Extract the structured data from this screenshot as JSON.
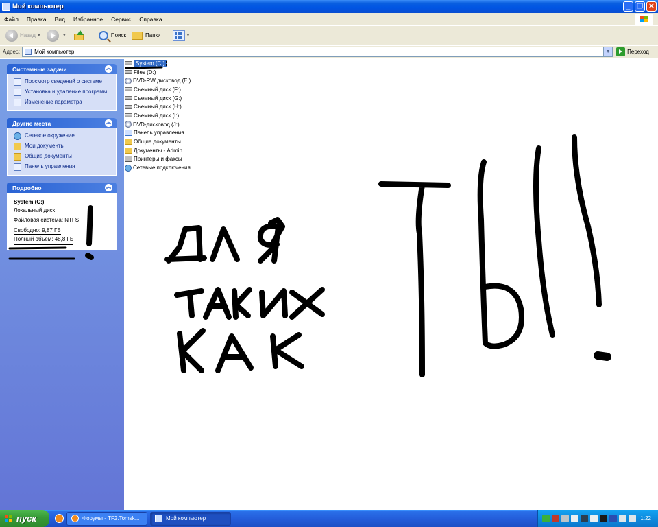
{
  "window": {
    "title": "Мой компьютер"
  },
  "menubar": {
    "items": [
      "Файл",
      "Правка",
      "Вид",
      "Избранное",
      "Сервис",
      "Справка"
    ]
  },
  "toolbar": {
    "back_label": "Назад",
    "search_label": "Поиск",
    "folders_label": "Папки"
  },
  "addressbar": {
    "label": "Адрес:",
    "value": "Мой компьютер",
    "go_label": "Переход"
  },
  "left_panel": {
    "system_tasks": {
      "title": "Системные задачи",
      "items": [
        "Просмотр сведений о системе",
        "Установка и удаление программ",
        "Изменение параметра"
      ]
    },
    "other_places": {
      "title": "Другие места",
      "items": [
        "Сетевое окружение",
        "Мои документы",
        "Общие документы",
        "Панель управления"
      ]
    },
    "details": {
      "title": "Подробно",
      "name": "System (C:)",
      "type": "Локальный диск",
      "filesystem": "Файловая система: NTFS",
      "free": "Свободно: 9,87 ГБ",
      "total": "Полный объем: 48,8 ГБ"
    }
  },
  "files": [
    {
      "name": "System (C:)",
      "icon": "hard-drive-icon"
    },
    {
      "name": "Files (D:)",
      "icon": "hard-drive-icon"
    },
    {
      "name": "DVD-RW дисковод (E:)",
      "icon": "cd-drive-icon"
    },
    {
      "name": "Съемный диск (F:)",
      "icon": "removable-disk-icon"
    },
    {
      "name": "Съемный диск (G:)",
      "icon": "removable-disk-icon"
    },
    {
      "name": "Съемный диск (H:)",
      "icon": "removable-disk-icon"
    },
    {
      "name": "Съемный диск (I:)",
      "icon": "removable-disk-icon"
    },
    {
      "name": "DVD-дисковод (J:)",
      "icon": "cd-drive-icon"
    },
    {
      "name": "Панель управления",
      "icon": "control-panel-icon"
    },
    {
      "name": "Общие документы",
      "icon": "folder-icon"
    },
    {
      "name": "Документы - Admin",
      "icon": "folder-icon"
    },
    {
      "name": "Принтеры и факсы",
      "icon": "printer-icon"
    },
    {
      "name": "Сетевые подключения",
      "icon": "network-icon"
    }
  ],
  "taskbar": {
    "start_label": "пуск",
    "tasks": [
      "Форумы - TF2.Tomsk...",
      "Мой компьютер"
    ],
    "clock": "1:22"
  },
  "colors": {
    "titlebar": "#0054e3",
    "selection": "#316ac5",
    "task_panel": "#6375d6",
    "start_button": "#379a37"
  }
}
